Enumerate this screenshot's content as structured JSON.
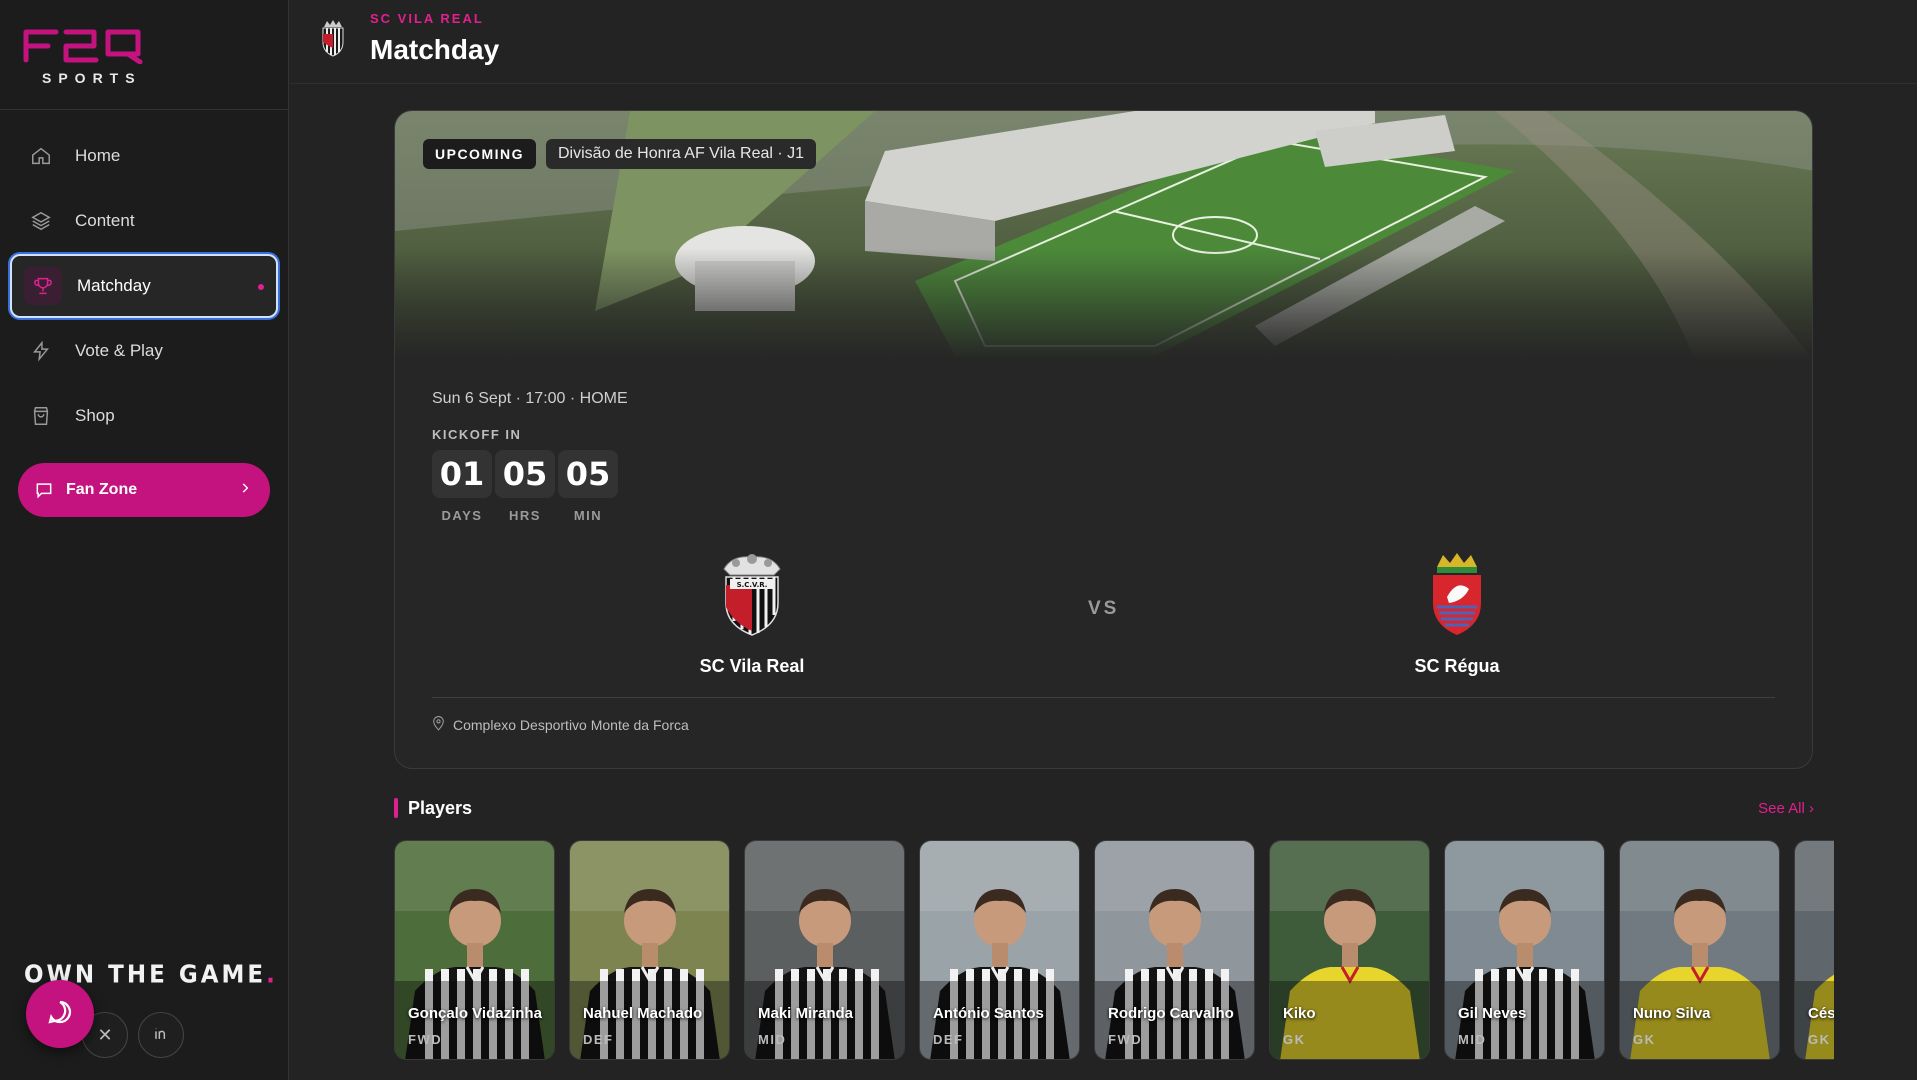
{
  "brand": {
    "logo_text": "F2Q",
    "subtitle": "SPORTS",
    "tagline": "OWN THE GAME",
    "accent": "#e0208f"
  },
  "nav": [
    {
      "label": "Home",
      "icon": "home-icon"
    },
    {
      "label": "Content",
      "icon": "layers-icon"
    },
    {
      "label": "Matchday",
      "icon": "trophy-icon",
      "active": true
    },
    {
      "label": "Vote & Play",
      "icon": "lightning-icon"
    },
    {
      "label": "Shop",
      "icon": "bag-icon"
    }
  ],
  "fanzone": {
    "label": "Fan Zone"
  },
  "header": {
    "club": "SC VILA REAL",
    "title": "Matchday"
  },
  "match": {
    "status": "UPCOMING",
    "competition": "Divisão de Honra AF Vila Real · J1",
    "meta": "Sun 6 Sept · 17:00 · HOME",
    "kickoff_label": "KICKOFF IN",
    "countdown": [
      {
        "value": "01",
        "unit": "DAYS"
      },
      {
        "value": "05",
        "unit": "HRS"
      },
      {
        "value": "05",
        "unit": "MIN"
      }
    ],
    "home": "SC Vila Real",
    "away": "SC Régua",
    "vs": "VS",
    "venue": "Complexo Desportivo Monte da Forca"
  },
  "players_section": {
    "title": "Players",
    "see_all": "See All"
  },
  "players": [
    {
      "name": "Gonçalo Vidazinha",
      "position": "FWD",
      "kit": "stripes"
    },
    {
      "name": "Nahuel Machado",
      "position": "DEF",
      "kit": "stripes"
    },
    {
      "name": "Maki Miranda",
      "position": "MID",
      "kit": "stripes"
    },
    {
      "name": "António Santos",
      "position": "DEF",
      "kit": "stripes"
    },
    {
      "name": "Rodrigo Carvalho",
      "position": "FWD",
      "kit": "stripes"
    },
    {
      "name": "Kiko",
      "position": "GK",
      "kit": "yellow"
    },
    {
      "name": "Gil Neves",
      "position": "MID",
      "kit": "stripes"
    },
    {
      "name": "Nuno Silva",
      "position": "GK",
      "kit": "yellow"
    },
    {
      "name": "Cés",
      "position": "GK",
      "kit": "yellow"
    }
  ]
}
